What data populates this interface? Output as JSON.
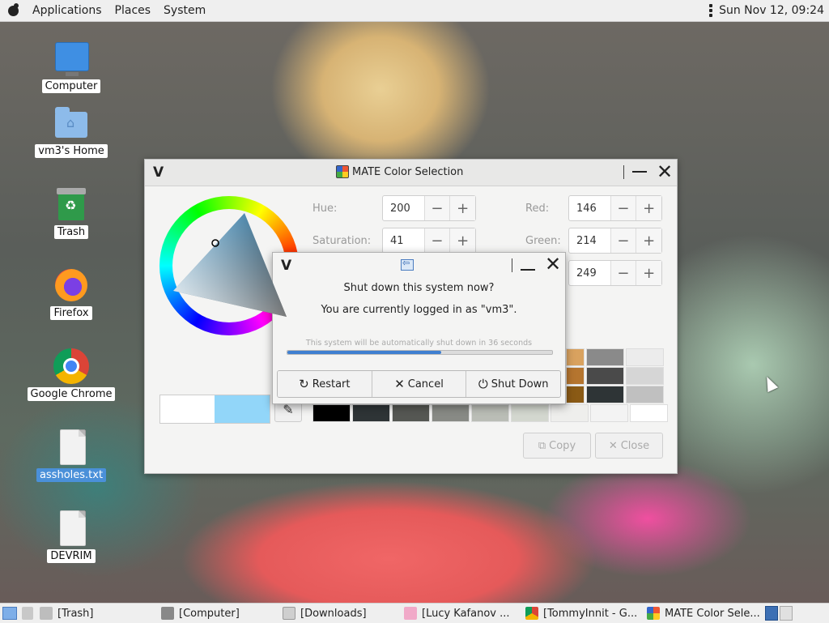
{
  "top_panel": {
    "menus": [
      "Applications",
      "Places",
      "System"
    ],
    "clock": "Sun Nov 12, 09:24"
  },
  "desktop": {
    "icons": [
      {
        "label": "Computer",
        "icon": "computer-icon"
      },
      {
        "label": "vm3's Home",
        "icon": "home-folder-icon"
      },
      {
        "label": "Trash",
        "icon": "trash-icon"
      },
      {
        "label": "Firefox",
        "icon": "firefox-icon"
      },
      {
        "label": "Google Chrome",
        "icon": "chrome-icon"
      },
      {
        "label": "assholes.txt",
        "icon": "text-file-icon",
        "selected": true
      },
      {
        "label": "DEVRIM",
        "icon": "file-icon"
      }
    ]
  },
  "color_window": {
    "title": "MATE Color Selection",
    "fields": {
      "hue": {
        "label": "Hue:",
        "value": "200"
      },
      "saturation": {
        "label": "Saturation:",
        "value": "41"
      },
      "red": {
        "label": "Red:",
        "value": "146"
      },
      "green": {
        "label": "Green:",
        "value": "214"
      },
      "blue": {
        "value": "249"
      }
    },
    "current_color": "#92d6f9",
    "previous_color": "#ffffff",
    "palette": {
      "row1": [
        "#d9a25f",
        "#8a8a8a",
        "#ececec"
      ],
      "row2": [
        "#b5752f",
        "#4a4a4a",
        "#d6d6d6"
      ],
      "row3": [
        "#8a5a15",
        "#2e3436",
        "#c0c0c0"
      ],
      "row4": [
        "#000000",
        "#2e3436",
        "#555753",
        "#888a85",
        "#babdb6",
        "#d3d7cf",
        "#eeeeec",
        "#f3f3f3",
        "#ffffff"
      ]
    },
    "copy_label": "Copy",
    "close_label": "Close"
  },
  "shutdown_dialog": {
    "question": "Shut down this system now?",
    "info": "You are currently logged in as \"vm3\".",
    "countdown": "This system will be automatically shut down in 36 seconds",
    "progress_percent": 58,
    "buttons": {
      "restart": "Restart",
      "cancel": "Cancel",
      "shutdown": "Shut Down"
    }
  },
  "taskbar": {
    "tasks": [
      {
        "label": "[Trash]",
        "icon": "ti-trash"
      },
      {
        "label": "[Computer]",
        "icon": "ti-comp"
      },
      {
        "label": "[Downloads]",
        "icon": "ti-dl"
      },
      {
        "label": "[Lucy Kafanov ...",
        "icon": "ti-lucy"
      },
      {
        "label": "[TommyInnit - G...",
        "icon": "ti-chrome"
      },
      {
        "label": "MATE Color Sele...",
        "icon": "ti-color"
      }
    ]
  }
}
